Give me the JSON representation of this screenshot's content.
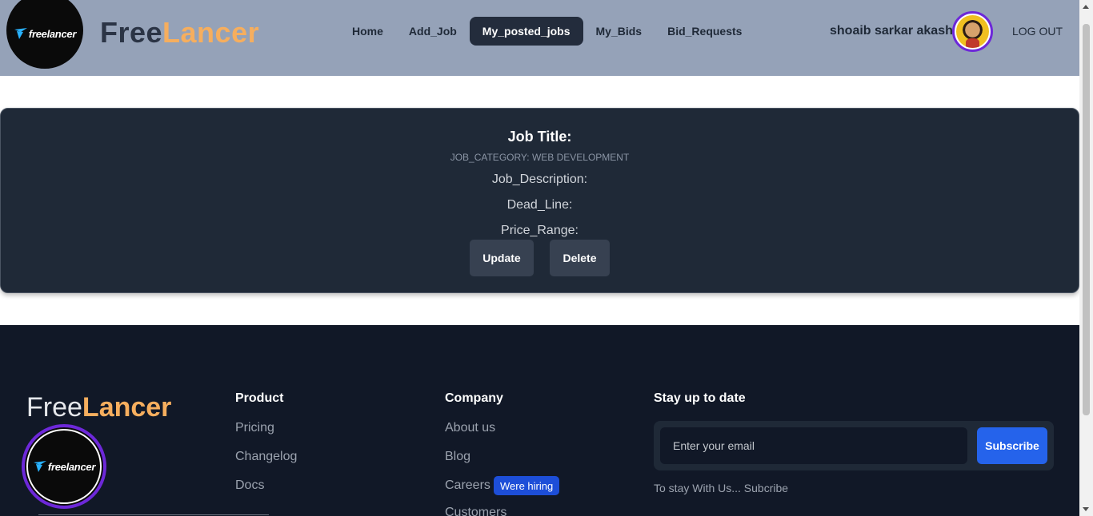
{
  "header": {
    "logo_text": "freelancer",
    "brand_first": "Free",
    "brand_second": "Lancer",
    "nav": [
      {
        "label": "Home"
      },
      {
        "label": "Add_Job"
      },
      {
        "label": "My_posted_jobs",
        "active": true
      },
      {
        "label": "My_Bids"
      },
      {
        "label": "Bid_Requests"
      }
    ],
    "user_name": "shoaib sarkar akash",
    "logout_label": "LOG OUT"
  },
  "job": {
    "title": "Job Title:",
    "category": "JOB_CATEGORY: WEB DEVELOPMENT",
    "description": "Job_Description:",
    "deadline": "Dead_Line:",
    "price_range": "Price_Range:",
    "update_label": "Update",
    "delete_label": "Delete"
  },
  "footer": {
    "brand_first": "Free",
    "brand_second": "Lancer",
    "logo_text": "freelancer",
    "product": {
      "heading": "Product",
      "links": [
        "Pricing",
        "Changelog",
        "Docs"
      ]
    },
    "company": {
      "heading": "Company",
      "links": [
        "About us",
        "Blog",
        "Careers",
        "Customers"
      ],
      "hiring_badge": "Were hiring"
    },
    "subscribe": {
      "heading": "Stay up to date",
      "placeholder": "Enter your email",
      "button": "Subscribe",
      "note": "To stay With Us... Subcribe"
    }
  },
  "colors": {
    "header_bg": "#95a2b8",
    "accent_orange": "#f6ae5e",
    "card_bg": "#1f2937",
    "footer_bg": "#111827",
    "subscribe_blue": "#2563eb",
    "avatar_ring": "#6d28d9"
  }
}
